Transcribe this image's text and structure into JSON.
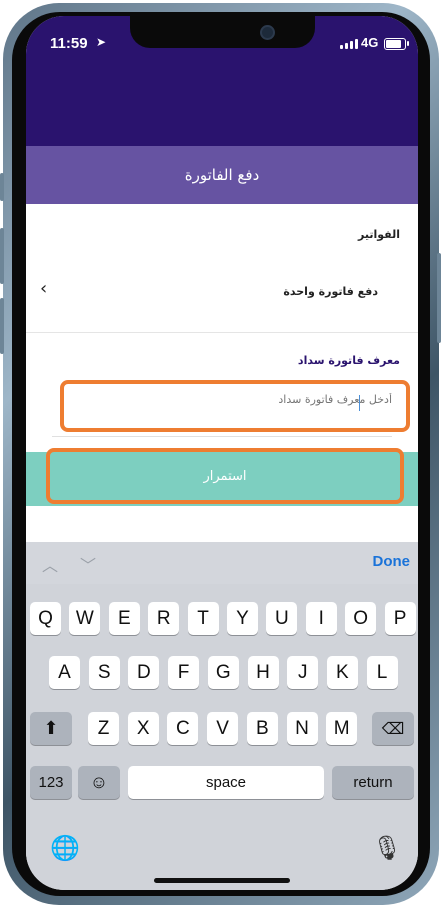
{
  "status": {
    "time": "11:59",
    "network": "4G"
  },
  "header": {
    "title": "دفع الفاتورة"
  },
  "section": {
    "label": "الفواتير"
  },
  "row": {
    "label": "دفع فاتورة واحدة"
  },
  "field": {
    "label": "معرف فاتورة سداد",
    "placeholder": "أدخل معرف فاتورة سداد",
    "value": ""
  },
  "button": {
    "label": "استمرار"
  },
  "keyboard": {
    "done": "Done",
    "row1": [
      "Q",
      "W",
      "E",
      "R",
      "T",
      "Y",
      "U",
      "I",
      "O",
      "P"
    ],
    "row2": [
      "A",
      "S",
      "D",
      "F",
      "G",
      "H",
      "J",
      "K",
      "L"
    ],
    "row3": [
      "Z",
      "X",
      "C",
      "V",
      "B",
      "N",
      "M"
    ],
    "numbers": "123",
    "space": "space",
    "return": "return"
  },
  "colors": {
    "topbar": "#2a136e",
    "titlebar": "#6653a2",
    "accent": "#7dcfc0",
    "highlight": "#ee7d31",
    "done": "#1a73d9"
  }
}
